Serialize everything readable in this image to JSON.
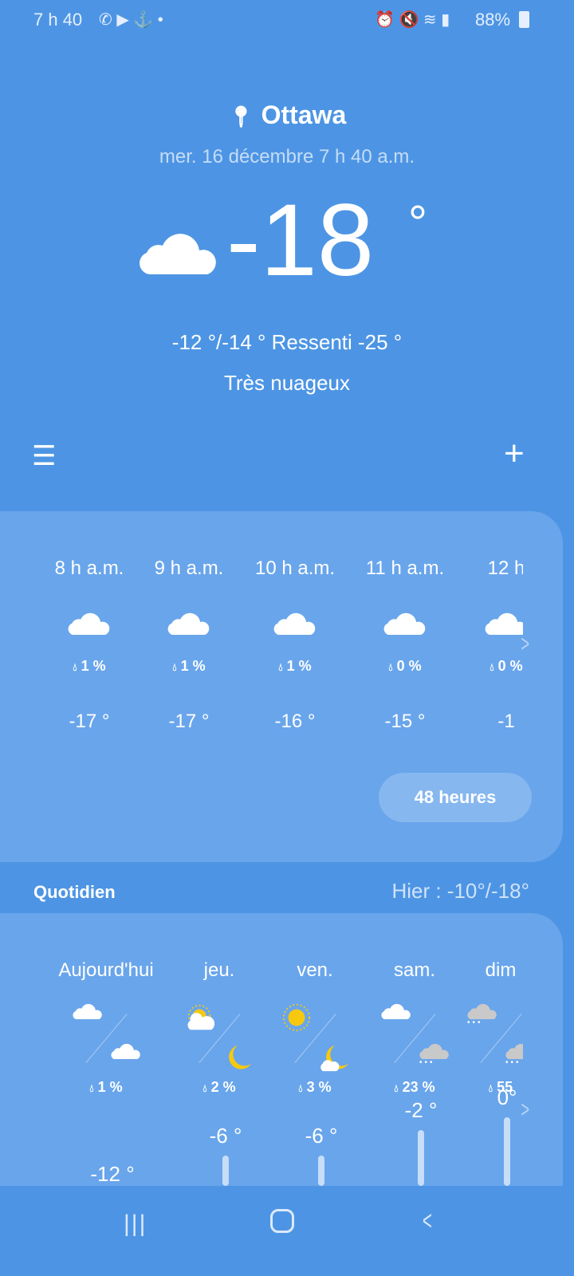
{
  "status_bar": {
    "time": "7 h 40",
    "battery": "88%",
    "icons": [
      "whatsapp-icon",
      "youtube-icon",
      "app-icon",
      "dot-icon",
      "alarm-icon",
      "mute-icon",
      "wifi-icon",
      "signal-icon",
      "battery-icon"
    ]
  },
  "location": {
    "city": "Ottawa",
    "datetime": "mer. 16 décembre 7 h 40 a.m."
  },
  "current": {
    "temp": "-18",
    "unit": "°",
    "icon": "cloud-icon",
    "hilo": "-12 °/-14 ° Ressenti -25 °",
    "condition": "Très nuageux"
  },
  "toolbar": {
    "menu_icon": "menu-icon",
    "add_icon": "plus-icon"
  },
  "hourly": {
    "items": [
      {
        "time": "8 h a.m.",
        "precip": "1 %",
        "temp": "-17 °"
      },
      {
        "time": "9 h a.m.",
        "precip": "1 %",
        "temp": "-17 °"
      },
      {
        "time": "10 h a.m.",
        "precip": "1 %",
        "temp": "-16 °"
      },
      {
        "time": "11 h a.m.",
        "precip": "0 %",
        "temp": "-15 °"
      },
      {
        "time": "12 h",
        "precip": "0 %",
        "temp": "-1"
      }
    ],
    "button": "48 heures"
  },
  "daily": {
    "title": "Quotidien",
    "yesterday": "Hier : -10°/-18°",
    "items": [
      {
        "day": "Aujourd'hui",
        "day_icon": "cloud",
        "night_icon": "cloud",
        "precip": "1 %",
        "high": "-12 °"
      },
      {
        "day": "jeu.",
        "day_icon": "partly-sunny",
        "night_icon": "moon",
        "precip": "2 %",
        "high": "-6 °"
      },
      {
        "day": "ven.",
        "day_icon": "sun",
        "night_icon": "moon-cloud",
        "precip": "3 %",
        "high": "-6 °"
      },
      {
        "day": "sam.",
        "day_icon": "cloud",
        "night_icon": "snow",
        "precip": "23 %",
        "high": "-2 °"
      },
      {
        "day": "dim",
        "day_icon": "snow",
        "night_icon": "snow",
        "precip": "55",
        "high": "0°"
      }
    ]
  },
  "colors": {
    "background": "#4d95e4",
    "card": "#69a5eb",
    "sun": "#f6c90e",
    "snow_cloud": "#c9c9c9"
  }
}
